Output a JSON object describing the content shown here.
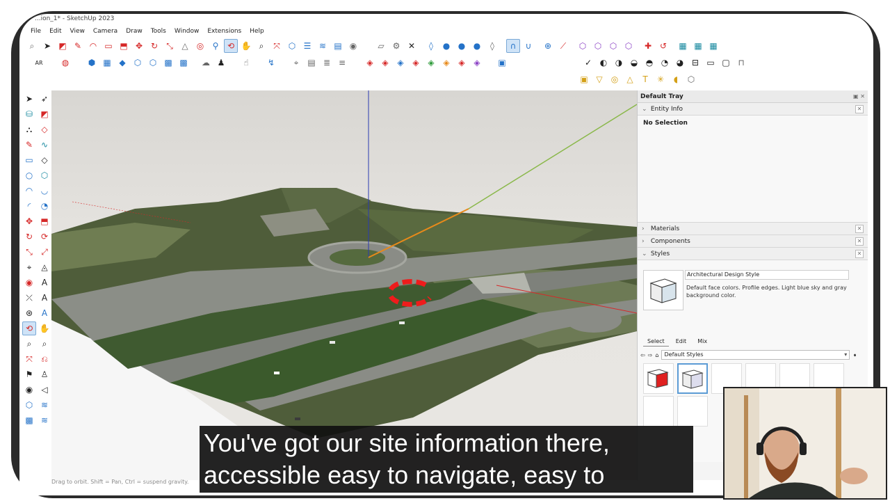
{
  "window": {
    "title": "...ion_1* - SketchUp 2023"
  },
  "menu": [
    "File",
    "Edit",
    "View",
    "Camera",
    "Draw",
    "Tools",
    "Window",
    "Extensions",
    "Help"
  ],
  "toolbar_icons": [
    "search-icon",
    "select-icon",
    "eraser-icon",
    "line-icon",
    "arc-icon",
    "rectangle-icon",
    "push-pull-icon",
    "move-icon",
    "rotate-icon",
    "scale-icon",
    "offset-icon",
    "orbit-icon",
    "pan-icon",
    "zoom-icon",
    "zoom-extents-icon",
    "component-icon",
    "layer-icon",
    "folder-icon",
    "settings-icon",
    "close-icon",
    "sandbox-icon",
    "magnet-icon"
  ],
  "viewport": {
    "status": "Drag to orbit. Shift = Pan, Ctrl = suspend gravity."
  },
  "tray": {
    "title": "Default Tray",
    "entity_info": {
      "label": "Entity Info",
      "selection": "No Selection"
    },
    "sections": [
      "Materials",
      "Components",
      "Styles"
    ],
    "styles": {
      "name": "Architectural Design Style",
      "description": "Default face colors. Profile edges. Light blue sky and gray background color.",
      "tabs": [
        "Select",
        "Edit",
        "Mix"
      ],
      "library": "Default Styles"
    }
  },
  "caption": {
    "line1": "You've got our site information there,",
    "line2": "accessible easy to navigate, easy to"
  },
  "colors": {
    "accent": "#2472c8",
    "axis_red": "#d62828",
    "axis_green": "#8ab84a",
    "axis_blue": "#2a3ab0"
  }
}
